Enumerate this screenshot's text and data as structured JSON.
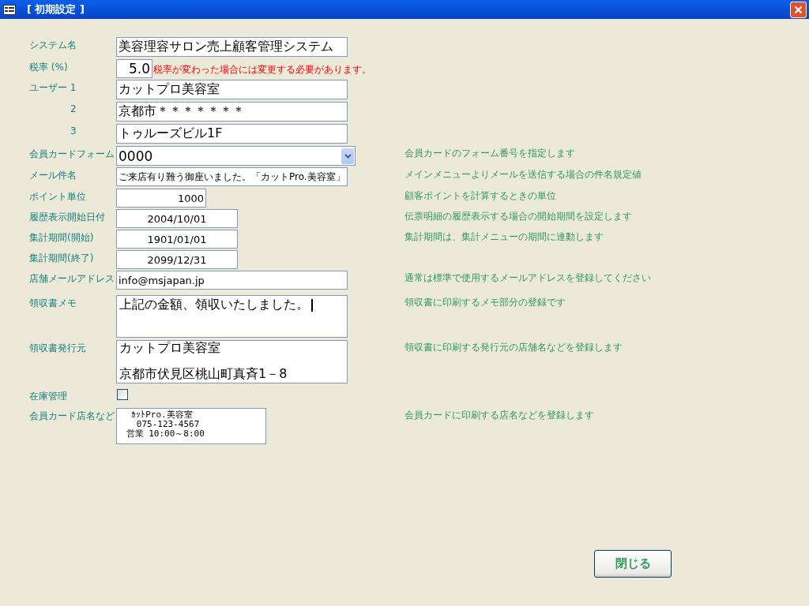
{
  "window": {
    "title": "[ 初期設定 ]"
  },
  "fields": [
    {
      "label": "システム名",
      "indent": false,
      "kind": "text",
      "value": "美容理容サロン売上顧客管理システム"
    },
    {
      "label": "税率 (%)",
      "indent": false,
      "kind": "rate",
      "value": "5.0",
      "note": "税率が変わった場合には変更する必要があります。"
    },
    {
      "label": "ユーザー 1",
      "indent": false,
      "kind": "text",
      "value": "カットプロ美容室"
    },
    {
      "label": "2",
      "indent": true,
      "kind": "text",
      "value": "京都市＊＊＊＊＊＊＊"
    },
    {
      "label": "3",
      "indent": true,
      "kind": "text",
      "value": "トゥルーズビル1F"
    },
    {
      "label": "会員カードフォーム",
      "indent": false,
      "kind": "select",
      "value": "0000",
      "hint": "会員カードのフォーム番号を指定します"
    },
    {
      "label": "メール件名",
      "indent": false,
      "kind": "text_small",
      "value": "ご来店有り難う御座いました。「カットPro.美容室」",
      "hint": "メインメニューよりメールを送信する場合の件名規定値"
    },
    {
      "label": "ポイント単位",
      "indent": false,
      "kind": "number",
      "value": "1000",
      "hint": "顧客ポイントを計算するときの単位"
    },
    {
      "label": "履歴表示開始日付",
      "indent": false,
      "kind": "date",
      "value": "2004/10/01",
      "hint": "伝票明細の履歴表示する場合の開始期間を設定します"
    },
    {
      "label": "集計期間(開始)",
      "indent": false,
      "kind": "date",
      "value": "1901/01/01",
      "hint": "集計期間は、集計メニューの期間に連動します"
    },
    {
      "label": "集計期間(終了)",
      "indent": false,
      "kind": "date",
      "value": "2099/12/31"
    },
    {
      "label": "店舗メールアドレス",
      "indent": false,
      "kind": "email",
      "value": "info@msjapan.jp",
      "hint": "通常は標準で使用するメールアドレスを登録してください"
    },
    {
      "label": "領収書メモ",
      "indent": false,
      "kind": "memo",
      "lines": [
        "上記の金額、領収いたしました。"
      ],
      "hint": "領収書に印刷するメモ部分の登録です"
    },
    {
      "label": "領収書発行元",
      "indent": false,
      "kind": "memo_tall",
      "lines": [
        "カットプロ美容室",
        "京都市伏見区桃山町真斉1－8"
      ],
      "hint": "領収書に印刷する発行元の店舗名などを登録します"
    },
    {
      "label": "在庫管理",
      "indent": false,
      "kind": "checkbox",
      "checked": false
    },
    {
      "label": "会員カード店名など",
      "indent": false,
      "kind": "card",
      "lines": [
        "  ｶｯﾄPro.美容室",
        "   075-123-4567",
        " 営業 10:00～8:00"
      ],
      "hint": "会員カードに印刷する店名などを登録します"
    }
  ],
  "close_button": "閉じる"
}
